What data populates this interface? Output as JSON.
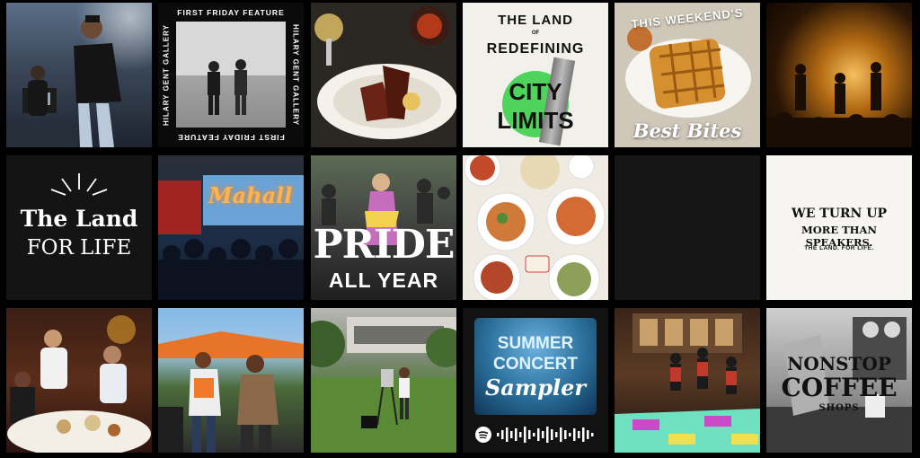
{
  "feed": {
    "tiles": {
      "first_friday": {
        "top": "FIRST FRIDAY FEATURE",
        "bottom": "FIRST FRIDAY FEATURE",
        "left": "HILARY GENT GALLERY",
        "right": "HILARY GENT GALLERY"
      },
      "redefining": {
        "line1": "THE LAND",
        "of": "OF",
        "line2": "REDEFINING",
        "line3": "CITY",
        "line4": "LIMITS"
      },
      "weekend": {
        "arc": "THIS WEEKEND'S",
        "script": "Best Bites"
      },
      "land_for_life": {
        "line1": "The Land",
        "line2": "FOR LIFE"
      },
      "mahall": {
        "sign": "Mahall"
      },
      "pride": {
        "line1": "PRIDE",
        "line2": "ALL YEAR"
      },
      "speakers": {
        "line1": "WE TURN UP",
        "line2": "MORE THAN SPEAKERS.",
        "tagline": "THE LAND. FOR LIFE."
      },
      "summer": {
        "line1": "SUMMER",
        "line2": "CONCERT",
        "line3": "Sampler"
      },
      "coffee": {
        "line1": "NONSTOP",
        "line2": "COFFEE",
        "line3": "SHOPS"
      }
    },
    "colors": {
      "background": "#000000",
      "green_circle": "#4ed45a",
      "summer_blue": "#2a6f9a",
      "summer_text": "#dff3ff"
    }
  }
}
